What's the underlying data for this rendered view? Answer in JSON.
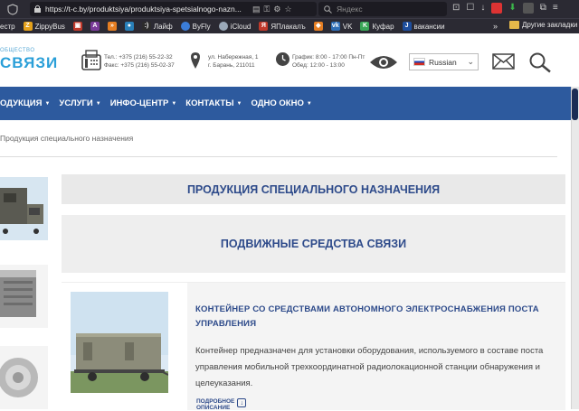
{
  "browser": {
    "tab_fragment": "естр",
    "url": "https://t-c.by/produktsiya/produktsiya-spetsialnogo-nazn...",
    "search_placeholder": "Яндекс",
    "bookmarks": [
      {
        "label": "естр",
        "color": "#2b2a33"
      },
      {
        "label": "ZippyBus",
        "color": "#e5a11a"
      },
      {
        "label": "",
        "color": "#c0392b"
      },
      {
        "label": "",
        "color": "#7a3b9a"
      },
      {
        "label": "",
        "color": "#e67e22"
      },
      {
        "label": "",
        "color": "#2980b9"
      },
      {
        "label": "Лайф",
        "color": "#2c2c2c"
      },
      {
        "label": "ByFly",
        "color": "#3b7dd8"
      },
      {
        "label": "iCloud",
        "color": "#9aa8b8"
      },
      {
        "label": "ЯПлакалъ",
        "color": "#c0392b"
      },
      {
        "label": "",
        "color": "#e67e22"
      },
      {
        "label": "VK",
        "color": "#2f6eb5"
      },
      {
        "label": "Куфар",
        "color": "#3aa657"
      },
      {
        "label": "вакансии",
        "color": "#1d4e9e"
      }
    ],
    "more_label": "»",
    "other_bookmarks": "Другие закладки"
  },
  "header": {
    "logo_small": "ОБЩЕСТВО",
    "logo_big": "СВЯЗИ",
    "phone": "Тел.: +375 (216) 55-22-32",
    "fax": "Факс: +375 (216) 55-02-37",
    "address_line1": "ул. Набережная, 1",
    "address_line2": "г. Барань, 211011",
    "hours_line1": "График: 8:00 - 17:00 Пн-Пт",
    "hours_line2": "Обед: 12:00 - 13:00",
    "language": "Russian"
  },
  "nav": {
    "items": [
      {
        "label": "ОДУКЦИЯ"
      },
      {
        "label": "УСЛУГИ"
      },
      {
        "label": "ИНФО-ЦЕНТР"
      },
      {
        "label": "КОНТАКТЫ"
      },
      {
        "label": "ОДНО ОКНО"
      }
    ]
  },
  "breadcrumb": "Продукция специального назначения",
  "main": {
    "title": "ПРОДУКЦИЯ СПЕЦИАЛЬНОГО НАЗНАЧЕНИЯ",
    "subtitle": "ПОДВИЖНЫЕ СРЕДСТВА СВЯЗИ",
    "product": {
      "title": "КОНТЕЙНЕР СО СРЕДСТВАМИ АВТОНОМНОГО ЭЛЕКТРОСНАБЖЕНИЯ ПОСТА УПРАВЛЕНИЯ",
      "description": "Контейнер предназначен для установки оборудования, используемого в составе поста управления мобильной трехкоординатной радиолокационной станции обнаружения и целеуказания.",
      "more_line1": "ПОДРОБНОЕ",
      "more_line2": "ОПИСАНИЕ"
    }
  },
  "colors": {
    "nav_bg": "#2d5a9e",
    "heading": "#2d4a8a",
    "logo": "#2a9fd8"
  }
}
